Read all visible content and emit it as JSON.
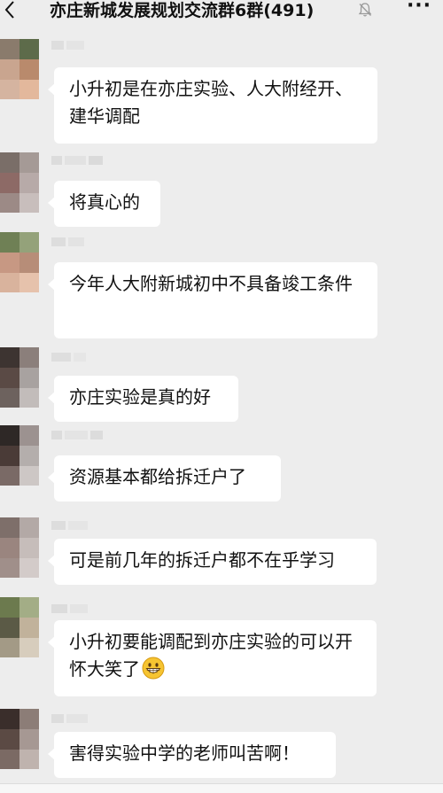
{
  "header": {
    "back_icon": "chevron-left-icon",
    "title": "亦庄新城发展规划交流群6群(491)",
    "mute_icon": "bell-muted-icon",
    "more_label": "···"
  },
  "messages": [
    {
      "text": "小升初是在亦庄实验、人大附经开、建华调配"
    },
    {
      "text": "将真心的"
    },
    {
      "text": "今年人大附新城初中不具备竣工条件"
    },
    {
      "text": "亦庄实验是真的好"
    },
    {
      "text": "资源基本都给拆迁户了"
    },
    {
      "text": "可是前几年的拆迁户都不在乎学习"
    },
    {
      "text": "小升初要能调配到亦庄实验的可以开怀大笑了",
      "emoji": "grinning-face-icon"
    },
    {
      "text": "害得实验中学的老师叫苦啊！"
    }
  ]
}
